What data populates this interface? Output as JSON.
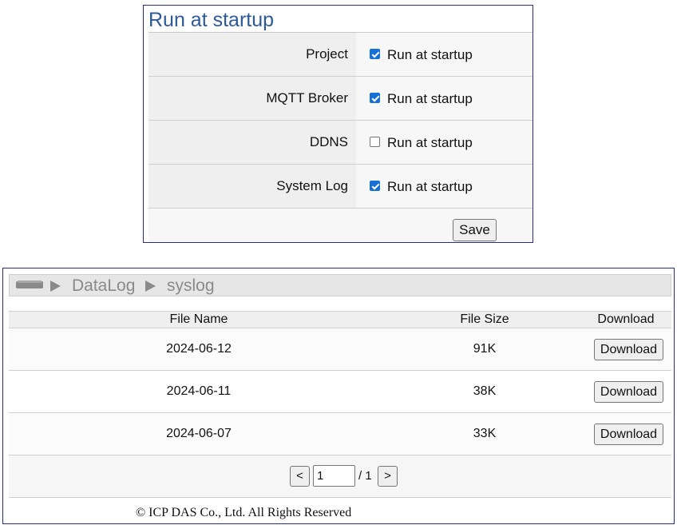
{
  "startup": {
    "title": "Run at startup",
    "rows": [
      {
        "label": "Project",
        "checked": true,
        "option": "Run at startup"
      },
      {
        "label": "MQTT Broker",
        "checked": true,
        "option": "Run at startup"
      },
      {
        "label": "DDNS",
        "checked": false,
        "option": "Run at startup"
      },
      {
        "label": "System Log",
        "checked": true,
        "option": "Run at startup"
      }
    ],
    "save_label": "Save"
  },
  "datalog": {
    "breadcrumb": [
      "DataLog",
      "syslog"
    ],
    "icons": {
      "drive": "drive-icon",
      "separator": "triangle-right-icon"
    },
    "columns": [
      "File Name",
      "File Size",
      "Download"
    ],
    "rows": [
      {
        "name": "2024-06-12",
        "size": "91K",
        "action": "Download"
      },
      {
        "name": "2024-06-11",
        "size": "38K",
        "action": "Download"
      },
      {
        "name": "2024-06-07",
        "size": "33K",
        "action": "Download"
      }
    ],
    "pager": {
      "prev": "<",
      "page": "1",
      "total": "/ 1",
      "next": ">"
    },
    "copyright": "© ICP DAS Co., Ltd. All Rights Reserved"
  },
  "colors": {
    "title_blue": "#2d5a96",
    "checkbox_blue": "#1670d8",
    "panel_border": "#2a2a8a",
    "crumb_gray": "#8a8a8a"
  }
}
